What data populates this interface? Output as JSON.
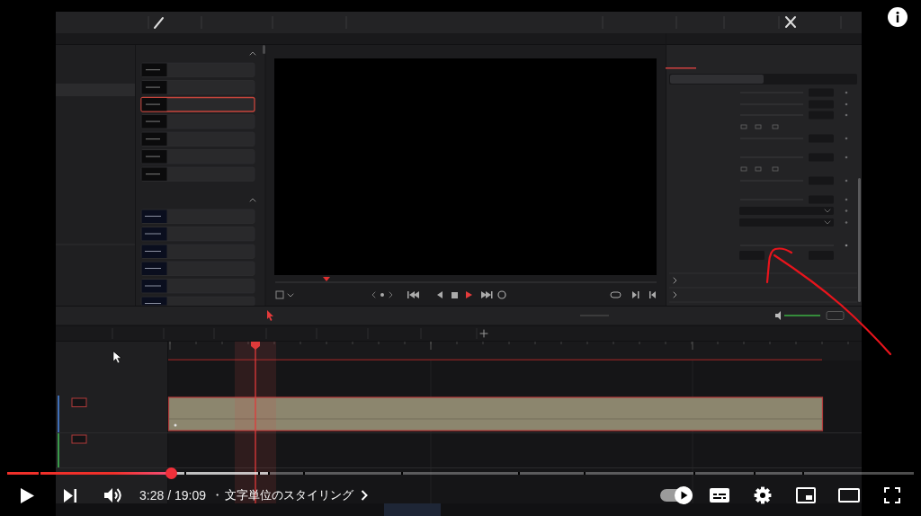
{
  "player": {
    "progress": {
      "level": 0.181,
      "buffer": {
        "level": 0.288
      }
    },
    "playing": false,
    "muted": false,
    "time": "3:28 / 19:09",
    "separator": "・",
    "chapter": "文字単位のスタイリング",
    "autoplay": {
      "on": true
    }
  }
}
